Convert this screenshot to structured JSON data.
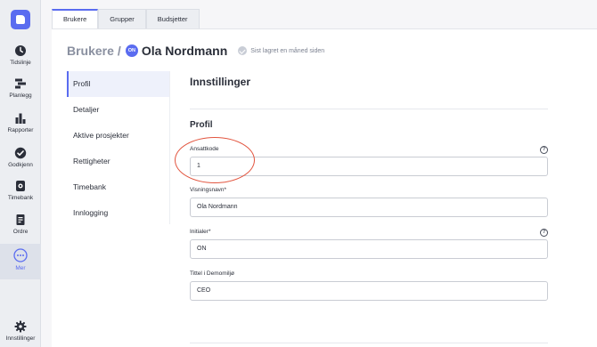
{
  "nav": {
    "items": [
      {
        "label": "Tidslinje",
        "icon": "clock-icon"
      },
      {
        "label": "Planlegg",
        "icon": "gantt-icon"
      },
      {
        "label": "Rapporter",
        "icon": "bar-chart-icon"
      },
      {
        "label": "Godkjenn",
        "icon": "check-circle-icon"
      },
      {
        "label": "Timebank",
        "icon": "piggy-bank-icon"
      },
      {
        "label": "Ordre",
        "icon": "document-icon"
      },
      {
        "label": "Mer",
        "icon": "more-icon"
      },
      {
        "label": "Innstillinger",
        "icon": "gear-icon"
      }
    ],
    "active": "Mer"
  },
  "tabs": [
    "Brukere",
    "Grupper",
    "Budsjetter"
  ],
  "active_tab": "Brukere",
  "breadcrumb": {
    "parent": "Brukere",
    "separator": "/",
    "avatar_initials": "ON",
    "name": "Ola Nordmann",
    "saved_text": "Sist lagret en måned siden"
  },
  "subnav": {
    "items": [
      "Profil",
      "Detaljer",
      "Aktive prosjekter",
      "Rettigheter",
      "Timebank",
      "Innlogging"
    ],
    "active": "Profil"
  },
  "content": {
    "title": "Innstillinger",
    "section": "Profil",
    "fields": [
      {
        "label": "Ansattkode",
        "value": "1",
        "help": "?"
      },
      {
        "label": "Visningsnavn*",
        "value": "Ola Nordmann"
      },
      {
        "label": "Initialer*",
        "value": "ON",
        "help": "?"
      },
      {
        "label": "Tittel i Demomiljø",
        "value": "CEO"
      }
    ]
  },
  "colors": {
    "accent": "#5a6cf0",
    "highlight": "#e2553f"
  }
}
